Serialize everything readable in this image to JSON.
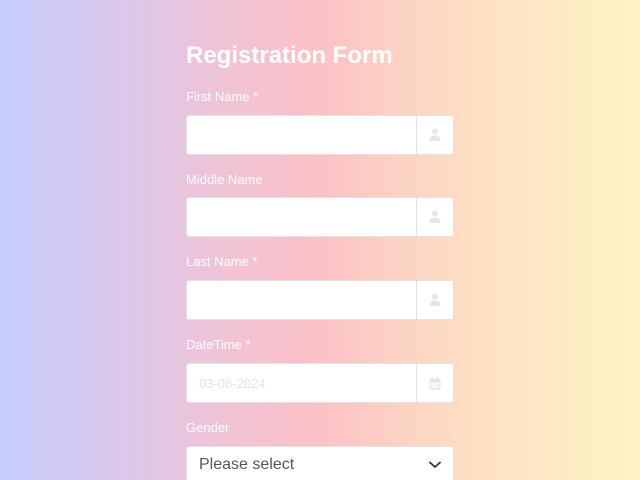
{
  "form": {
    "title": "Registration Form",
    "fields": {
      "first_name": {
        "label": "First Name *",
        "value": "",
        "icon": "user-icon"
      },
      "middle_name": {
        "label": "Middle Name",
        "value": "",
        "icon": "user-icon"
      },
      "last_name": {
        "label": "Last Name *",
        "value": "",
        "icon": "user-icon"
      },
      "datetime": {
        "label": "DateTime *",
        "value": "",
        "placeholder": "03-08-2024",
        "icon": "calendar-icon"
      },
      "gender": {
        "label": "Gender",
        "selected": "Please select",
        "icon": "chevron-down-icon"
      }
    }
  },
  "colors": {
    "icon": "#e6e6e6",
    "label": "#ffffff",
    "border": "#e2e2e2"
  }
}
